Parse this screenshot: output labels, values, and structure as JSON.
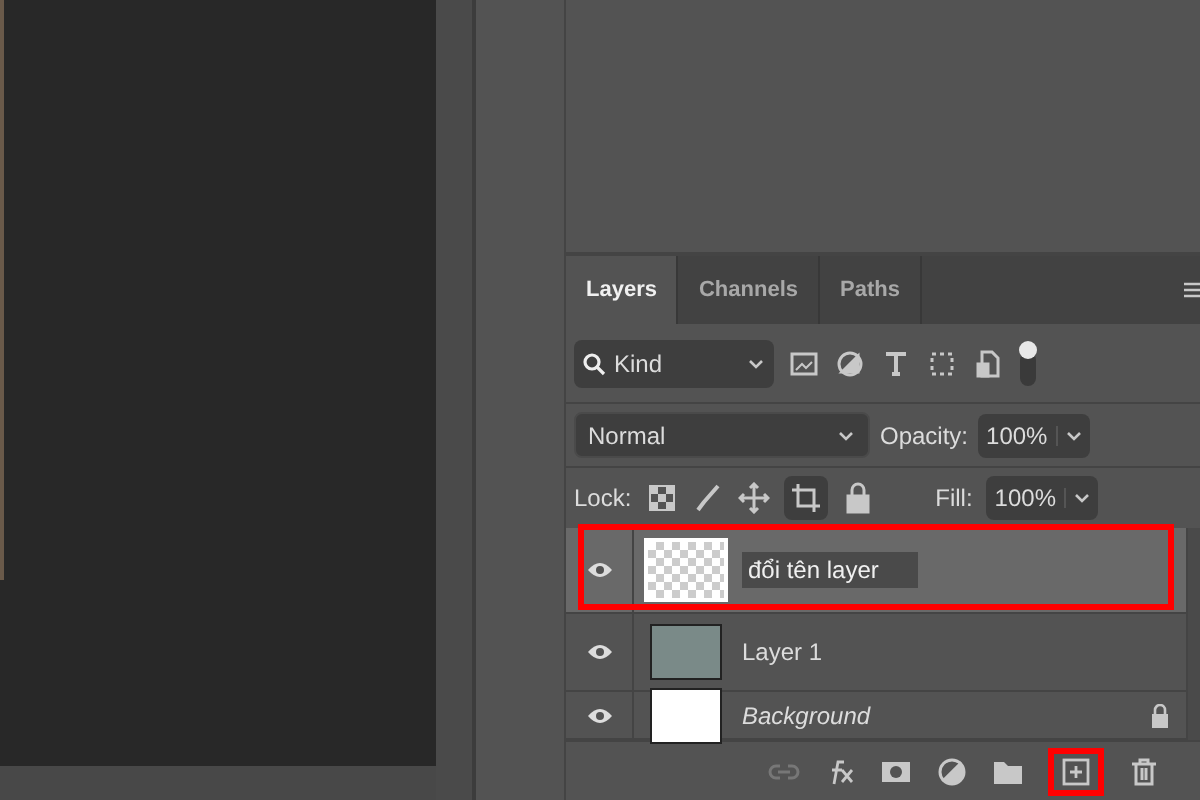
{
  "tabs": [
    {
      "label": "Layers",
      "selected": true
    },
    {
      "label": "Channels",
      "selected": false
    },
    {
      "label": "Paths",
      "selected": false
    }
  ],
  "filter": {
    "value": "Kind"
  },
  "blend_mode": {
    "value": "Normal"
  },
  "opacity": {
    "label": "Opacity:",
    "value": "100%"
  },
  "lock": {
    "label": "Lock:",
    "artboard_lock_on": true
  },
  "fill": {
    "label": "Fill:",
    "value": "100%"
  },
  "layers": [
    {
      "name": "đổi tên layer",
      "kind": "transparent",
      "visible": true,
      "selected": true,
      "editing": true,
      "locked": false,
      "highlighted": true
    },
    {
      "name": "Layer 1",
      "kind": "photo",
      "visible": true,
      "selected": false,
      "editing": false,
      "locked": false,
      "highlighted": false
    },
    {
      "name": "Background",
      "kind": "white",
      "visible": true,
      "selected": false,
      "editing": false,
      "locked": true,
      "highlighted": false
    }
  ],
  "toolbar": {
    "new_layer_highlighted": true
  }
}
